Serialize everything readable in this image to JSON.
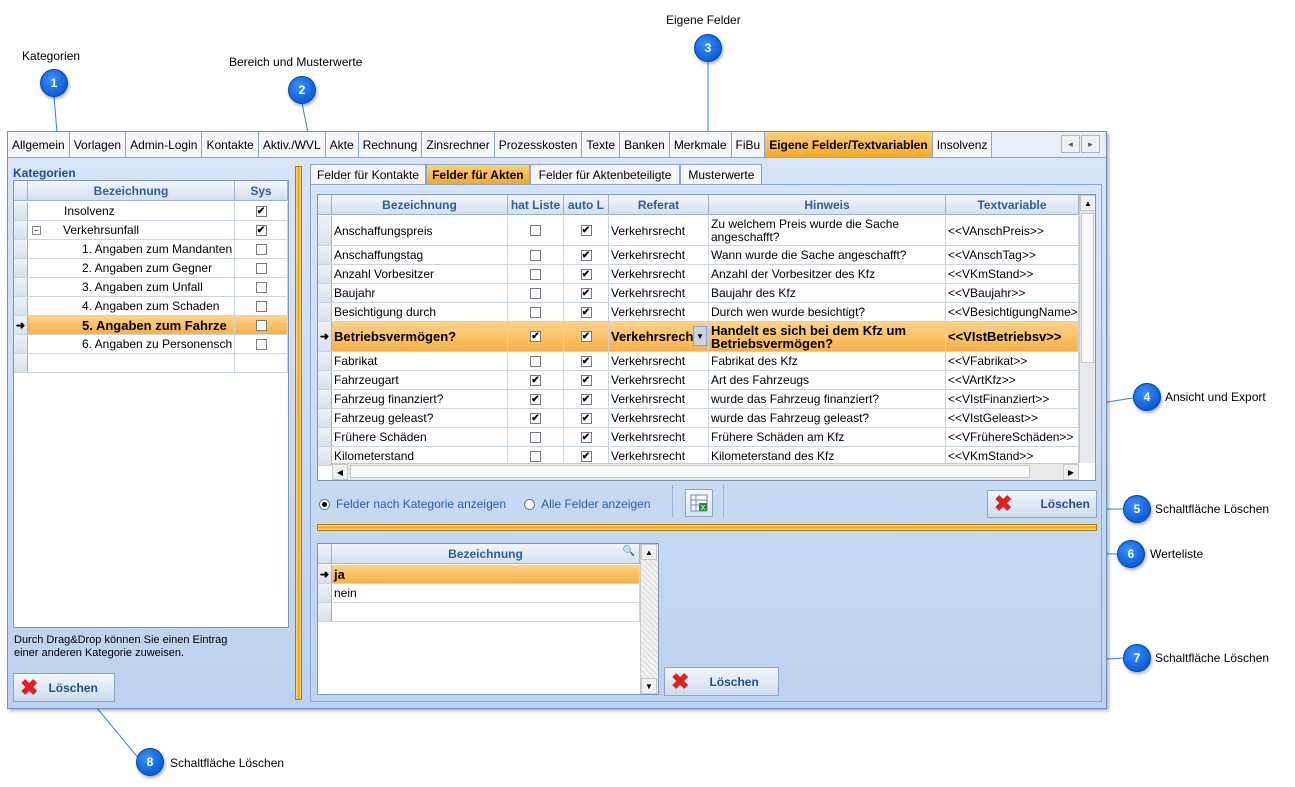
{
  "callouts": [
    {
      "num": "1",
      "label": "Kategorien"
    },
    {
      "num": "2",
      "label": "Bereich und Musterwerte"
    },
    {
      "num": "3",
      "label": "Eigene Felder"
    },
    {
      "num": "4",
      "label": "Ansicht und Export"
    },
    {
      "num": "5",
      "label": "Schaltfläche Löschen"
    },
    {
      "num": "6",
      "label": "Werteliste"
    },
    {
      "num": "7",
      "label": "Schaltfläche Löschen"
    },
    {
      "num": "8",
      "label": "Schaltfläche Löschen"
    }
  ],
  "main_tabs": [
    "Allgemein",
    "Vorlagen",
    "Admin-Login",
    "Kontakte",
    "Aktiv./WVL",
    "Akte",
    "Rechnung",
    "Zinsrechner",
    "Prozesskosten",
    "Texte",
    "Banken",
    "Merkmale",
    "FiBu",
    "Eigene Felder/Textvariablen",
    "Insolvenz"
  ],
  "nav": {
    "prev": "◂",
    "next": "▸"
  },
  "left": {
    "heading": "Kategorien",
    "col_bezeichnung": "Bezeichnung",
    "col_sys": "Sys",
    "rows": [
      {
        "label": "Insolvenz",
        "sys": "✔"
      },
      {
        "label": "Verkehrsunfall",
        "sys": "✔"
      },
      {
        "label": "1. Angaben zum Mandanten",
        "sys": ""
      },
      {
        "label": "2. Angaben zum Gegner",
        "sys": ""
      },
      {
        "label": "3. Angaben zum Unfall",
        "sys": ""
      },
      {
        "label": "4. Angaben zum Schaden",
        "sys": ""
      },
      {
        "label": "5. Angaben zum Fahrze",
        "sys": ""
      },
      {
        "label": "6. Angaben zu Personensch",
        "sys": ""
      }
    ],
    "hint_line1": "Durch Drag&Drop können Sie einen Eintrag",
    "hint_line2": "einer anderen Kategorie zuweisen.",
    "delete_label": "Löschen"
  },
  "sub_tabs": [
    "Felder für Kontakte",
    "Felder für Akten",
    "Felder für Aktenbeteiligte",
    "Musterwerte"
  ],
  "fields": {
    "headers": [
      "Bezeichnung",
      "hat Liste",
      "auto L",
      "Referat",
      "Hinweis",
      "Textvariable"
    ],
    "rows": [
      {
        "bez": "Anschaffungspreis",
        "liste": "",
        "auto": "✔",
        "ref": "Verkehrsrecht",
        "hinweis1": "Zu welchem Preis wurde die Sache",
        "hinweis2": "angeschafft?",
        "var": "<<VAnschPreis>>"
      },
      {
        "bez": "Anschaffungstag",
        "liste": "",
        "auto": "✔",
        "ref": "Verkehrsrecht",
        "hinweis1": "Wann wurde die Sache angeschafft?",
        "hinweis2": "",
        "var": "<<VAnschTag>>"
      },
      {
        "bez": "Anzahl Vorbesitzer",
        "liste": "",
        "auto": "✔",
        "ref": "Verkehrsrecht",
        "hinweis1": "Anzahl der Vorbesitzer des Kfz",
        "hinweis2": "",
        "var": "<<VKmStand>>"
      },
      {
        "bez": "Baujahr",
        "liste": "",
        "auto": "✔",
        "ref": "Verkehrsrecht",
        "hinweis1": "Baujahr des Kfz",
        "hinweis2": "",
        "var": "<<VBaujahr>>"
      },
      {
        "bez": "Besichtigung durch",
        "liste": "",
        "auto": "✔",
        "ref": "Verkehrsrecht",
        "hinweis1": "Durch wen wurde besichtigt?",
        "hinweis2": "",
        "var": "<<VBesichtigungName>"
      },
      {
        "bez": "Betriebsvermögen?",
        "liste": "✔",
        "auto": "✔",
        "ref": "Verkehrsrech",
        "hinweis1": "Handelt es sich bei dem Kfz um",
        "hinweis2": "Betriebsvermögen?",
        "var": "<<VIstBetriebsv>>"
      },
      {
        "bez": "Fabrikat",
        "liste": "",
        "auto": "✔",
        "ref": "Verkehrsrecht",
        "hinweis1": "Fabrikat des Kfz",
        "hinweis2": "",
        "var": "<<VFabrikat>>"
      },
      {
        "bez": "Fahrzeugart",
        "liste": "✔",
        "auto": "✔",
        "ref": "Verkehrsrecht",
        "hinweis1": "Art des Fahrzeugs",
        "hinweis2": "",
        "var": "<<VArtKfz>>"
      },
      {
        "bez": "Fahrzeug finanziert?",
        "liste": "✔",
        "auto": "✔",
        "ref": "Verkehrsrecht",
        "hinweis1": "wurde das Fahrzeug finanziert?",
        "hinweis2": "",
        "var": "<<VIstFinanziert>>"
      },
      {
        "bez": "Fahrzeug geleast?",
        "liste": "✔",
        "auto": "✔",
        "ref": "Verkehrsrecht",
        "hinweis1": "wurde das Fahrzeug geleast?",
        "hinweis2": "",
        "var": "<<VIstGeleast>>"
      },
      {
        "bez": "Frühere Schäden",
        "liste": "",
        "auto": "✔",
        "ref": "Verkehrsrecht",
        "hinweis1": "Frühere Schäden am Kfz",
        "hinweis2": "",
        "var": "<<VFrühereSchäden>>"
      },
      {
        "bez": "Kilometerstand",
        "liste": "",
        "auto": "✔",
        "ref": "Verkehrsrecht",
        "hinweis1": "Kilometerstand des Kfz",
        "hinweis2": "",
        "var": "<<VKmStand>>"
      }
    ]
  },
  "view": {
    "radio1": "Felder nach Kategorie anzeigen",
    "radio2": "Alle Felder anzeigen",
    "delete_label": "Löschen"
  },
  "values": {
    "header": "Bezeichnung",
    "rows": [
      "ja",
      "nein"
    ],
    "delete_label": "Löschen"
  }
}
